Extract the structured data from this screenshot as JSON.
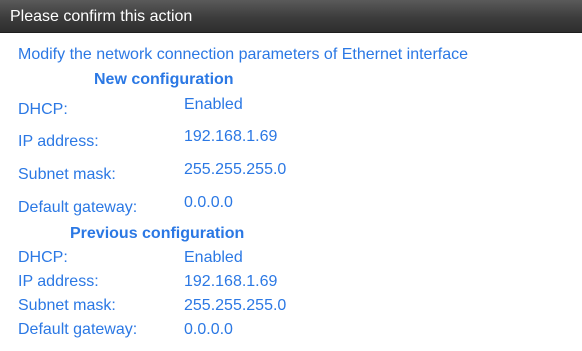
{
  "window": {
    "title": "Please confirm this action"
  },
  "message": "Modify the network connection parameters of Ethernet interface",
  "new_configuration": {
    "heading": "New configuration",
    "dhcp_label": "DHCP:",
    "dhcp_value": "Enabled",
    "ip_label": "IP address:",
    "ip_value": "192.168.1.69",
    "mask_label": "Subnet mask:",
    "mask_value": "255.255.255.0",
    "gateway_label": "Default gateway:",
    "gateway_value": "0.0.0.0"
  },
  "previous_configuration": {
    "heading": "Previous configuration",
    "dhcp_label": "DHCP:",
    "dhcp_value": "Enabled",
    "ip_label": "IP address:",
    "ip_value": "192.168.1.69",
    "mask_label": "Subnet mask:",
    "mask_value": "255.255.255.0",
    "gateway_label": "Default gateway:",
    "gateway_value": "0.0.0.0"
  },
  "colors": {
    "text_accent": "#2b78e4",
    "titlebar": "#3c3c3c",
    "title_text": "#ffffff",
    "background": "#ffffff"
  }
}
